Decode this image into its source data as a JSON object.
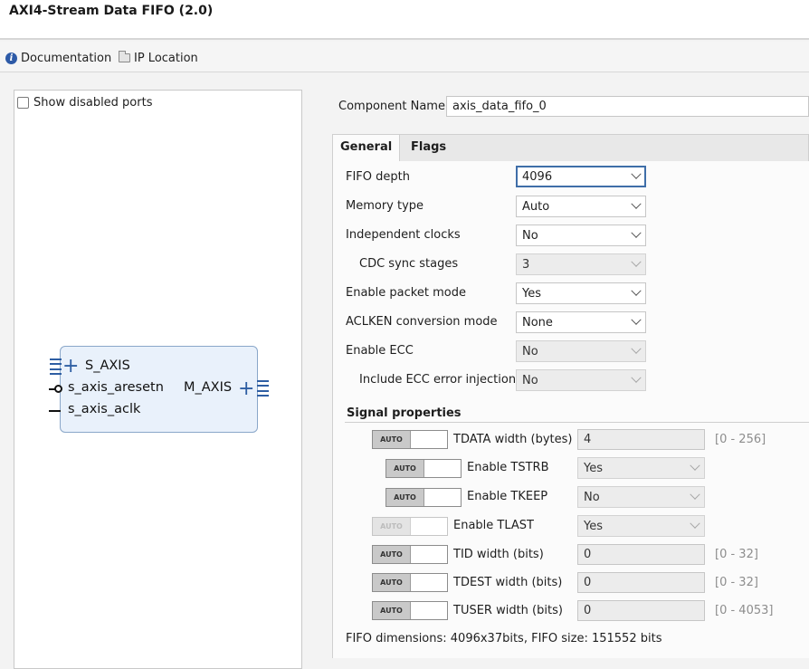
{
  "window": {
    "title": "AXI4-Stream Data FIFO (2.0)"
  },
  "toolbar": {
    "documentation": "Documentation",
    "ip_location": "IP Location"
  },
  "left_panel": {
    "show_disabled_ports": "Show disabled ports",
    "block": {
      "ports_left": [
        "S_AXIS",
        "s_axis_aresetn",
        "s_axis_aclk"
      ],
      "port_right": "M_AXIS"
    }
  },
  "component": {
    "label": "Component Name",
    "value": "axis_data_fifo_0"
  },
  "tabs": [
    {
      "label": "General",
      "active": true
    },
    {
      "label": "Flags",
      "active": false
    }
  ],
  "general": {
    "fields": [
      {
        "label": "FIFO depth",
        "value": "4096",
        "state": "focused"
      },
      {
        "label": "Memory type",
        "value": "Auto",
        "state": "enabled"
      },
      {
        "label": "Independent clocks",
        "value": "No",
        "state": "enabled"
      },
      {
        "label": "CDC sync stages",
        "value": "3",
        "state": "disabled"
      },
      {
        "label": "Enable packet mode",
        "value": "Yes",
        "state": "enabled"
      },
      {
        "label": "ACLKEN conversion mode",
        "value": "None",
        "state": "enabled"
      },
      {
        "label": "Enable ECC",
        "value": "No",
        "state": "disabled"
      },
      {
        "label": "Include ECC error injection",
        "value": "No",
        "state": "disabled"
      }
    ]
  },
  "signal_properties": {
    "title": "Signal properties",
    "auto_label": "AUTO",
    "rows": [
      {
        "label": "TDATA width (bytes)",
        "value": "4",
        "kind": "text",
        "range": "[0 - 256]"
      },
      {
        "label": "Enable TSTRB",
        "value": "Yes",
        "kind": "select",
        "range": ""
      },
      {
        "label": "Enable TKEEP",
        "value": "No",
        "kind": "select",
        "range": ""
      },
      {
        "label": "Enable TLAST",
        "value": "Yes",
        "kind": "select",
        "range": ""
      },
      {
        "label": "TID width (bits)",
        "value": "0",
        "kind": "text",
        "range": "[0 - 32]"
      },
      {
        "label": "TDEST width (bits)",
        "value": "0",
        "kind": "text",
        "range": "[0 - 32]"
      },
      {
        "label": "TUSER width (bits)",
        "value": "0",
        "kind": "text",
        "range": "[0 - 4053]"
      }
    ]
  },
  "footer": {
    "text": "FIFO dimensions: 4096x37bits, FIFO size: 151552 bits"
  },
  "colors": {
    "accent": "#2e5ea3",
    "focus_border": "#3f6ea8",
    "block_fill": "#e9f1fb"
  }
}
